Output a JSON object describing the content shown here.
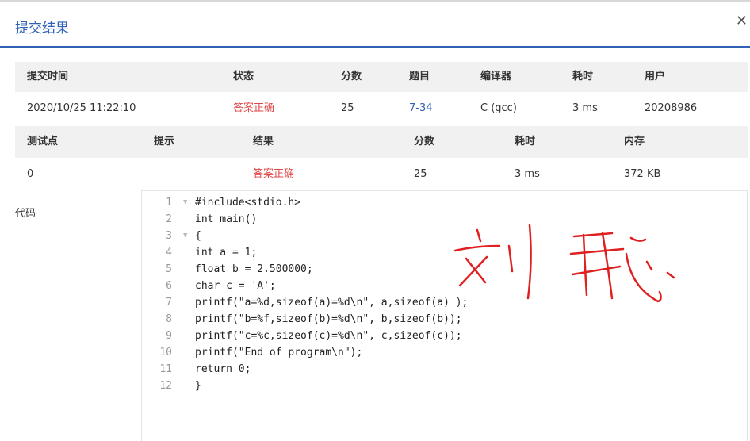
{
  "dialog": {
    "title": "提交结果",
    "close_icon": "close-icon"
  },
  "summary": {
    "headers": [
      "提交时间",
      "状态",
      "分数",
      "题目",
      "编译器",
      "耗时",
      "用户"
    ],
    "values": [
      "2020/10/25 11:22:10",
      "答案正确",
      "25",
      "7-34",
      "C (gcc)",
      "3 ms",
      "20208986"
    ]
  },
  "testcases": {
    "headers": [
      "测试点",
      "提示",
      "结果",
      "分数",
      "耗时",
      "内存"
    ],
    "values": [
      "0",
      "",
      "答案正确",
      "25",
      "3 ms",
      "372 KB"
    ]
  },
  "code": {
    "label": "代码",
    "line_numbers": [
      "1",
      "2",
      "3",
      "4",
      "5",
      "6",
      "7",
      "8",
      "9",
      "10",
      "11",
      "12"
    ],
    "lines": [
      "#include<stdio.h>",
      "int main()",
      "{",
      "int a = 1;",
      "float b = 2.500000;",
      "char c = 'A';",
      "printf(\"a=%d,sizeof(a)=%d\\n\", a,sizeof(a) );",
      "printf(\"b=%f,sizeof(b)=%d\\n\", b,sizeof(b));",
      "printf(\"c=%c,sizeof(c)=%d\\n\", c,sizeof(c));",
      "printf(\"End of program\\n\");",
      "return 0;",
      "}"
    ]
  },
  "colors": {
    "accent": "#2f62b5",
    "success": "#e04545",
    "handwriting": "#e02020"
  }
}
